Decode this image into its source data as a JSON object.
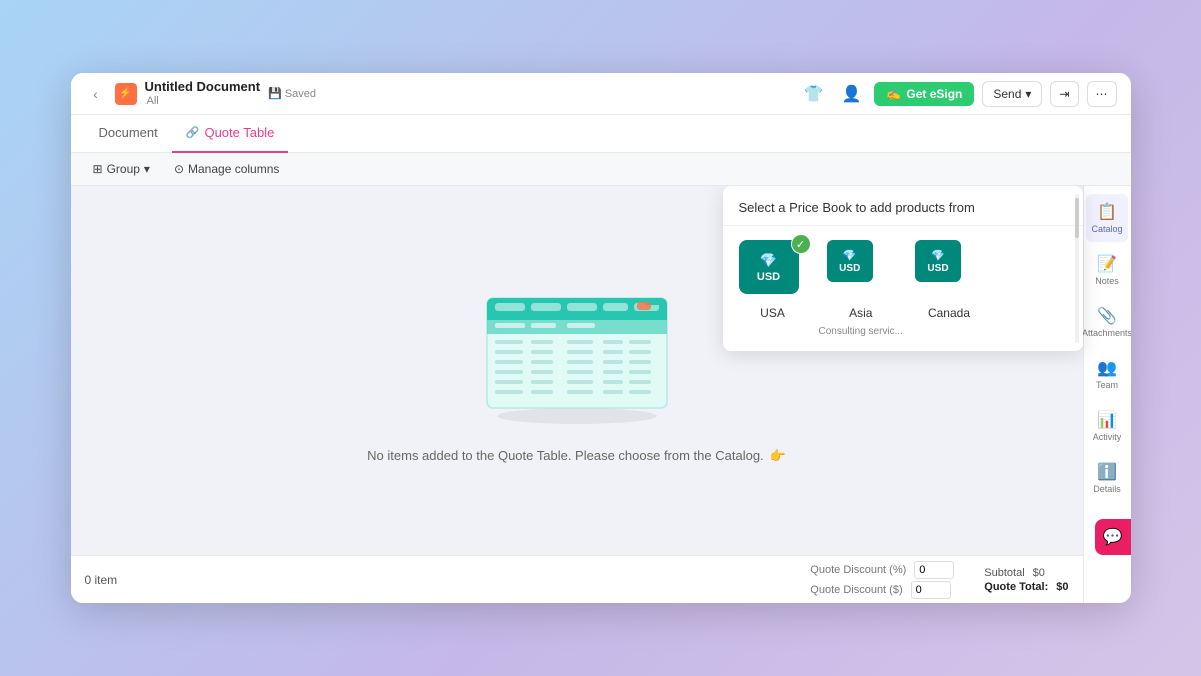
{
  "window": {
    "title": "Untitled Document",
    "saved_label": "Saved",
    "all_label": "All",
    "app_icon": "/"
  },
  "topbar": {
    "get_esign_label": "Get eSign",
    "send_label": "Send",
    "share_icon": "share",
    "more_icon": "more"
  },
  "tabs": [
    {
      "label": "Document",
      "active": false
    },
    {
      "label": "Quote Table",
      "active": true
    }
  ],
  "toolbar": {
    "group_label": "Group",
    "manage_columns_label": "Manage columns"
  },
  "empty": {
    "message": "No items added to the Quote Table. Please choose from the Catalog."
  },
  "footer": {
    "items_count": "0 item",
    "quote_discount_percent_label": "Quote Discount (%)",
    "quote_discount_percent_value": "0",
    "quote_discount_dollar_label": "Quote Discount ($)",
    "quote_discount_dollar_value": "0",
    "subtotal_label": "Subtotal",
    "subtotal_value": "$0",
    "quote_total_label": "Quote Total:",
    "quote_total_value": "$0"
  },
  "sidebar": [
    {
      "icon": "📋",
      "label": "Catalog",
      "active": true
    },
    {
      "icon": "📝",
      "label": "Notes",
      "active": false
    },
    {
      "icon": "📎",
      "label": "Attachments",
      "active": false
    },
    {
      "icon": "👥",
      "label": "Team",
      "active": false
    },
    {
      "icon": "📊",
      "label": "Activity",
      "active": false
    },
    {
      "icon": "ℹ️",
      "label": "Details",
      "active": false
    }
  ],
  "price_book_popup": {
    "header": "Select a Price Book to add products from",
    "books": [
      {
        "name": "USA",
        "subtitle": "",
        "currency": "USD",
        "selected": true
      },
      {
        "name": "Asia",
        "subtitle": "Consulting servic...",
        "currency": "USD",
        "selected": false
      },
      {
        "name": "Canada",
        "subtitle": "",
        "currency": "USD",
        "selected": false
      }
    ]
  }
}
